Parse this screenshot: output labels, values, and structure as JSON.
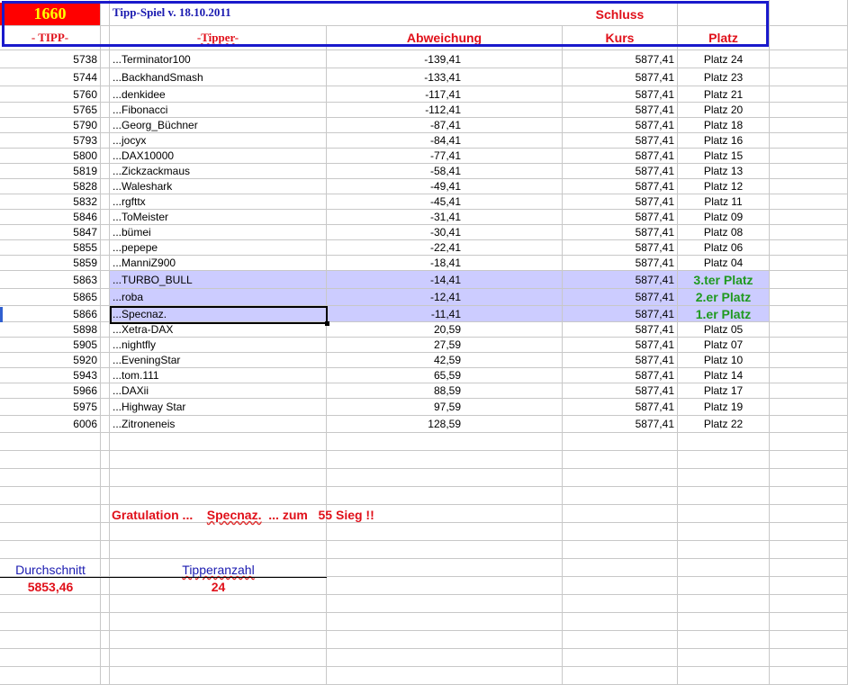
{
  "header": {
    "id_number": "1660",
    "title": "Tipp-Spiel v. 18.10.2011",
    "schluss": "Schluss",
    "col_tipp": "- TIPP-",
    "col_tipper": "-Tipper-",
    "col_abweichung": "Abweichung",
    "col_kurs": "Kurs",
    "col_platz": "Platz"
  },
  "rows": [
    {
      "tipp": "5738",
      "tipper": "...Terminator100",
      "abw": "-139,41",
      "kurs": "5877,41",
      "platz": "Platz 24"
    },
    {
      "tipp": "5744",
      "tipper": "...BackhandSmash",
      "abw": "-133,41",
      "kurs": "5877,41",
      "platz": "Platz 23"
    },
    {
      "tipp": "5760",
      "tipper": "...denkidee",
      "abw": "-117,41",
      "kurs": "5877,41",
      "platz": "Platz 21"
    },
    {
      "tipp": "5765",
      "tipper": "...Fibonacci",
      "abw": "-112,41",
      "kurs": "5877,41",
      "platz": "Platz 20"
    },
    {
      "tipp": "5790",
      "tipper": "...Georg_Büchner",
      "abw": "-87,41",
      "kurs": "5877,41",
      "platz": "Platz 18"
    },
    {
      "tipp": "5793",
      "tipper": "...jocyx",
      "abw": "-84,41",
      "kurs": "5877,41",
      "platz": "Platz 16"
    },
    {
      "tipp": "5800",
      "tipper": "...DAX10000",
      "abw": "-77,41",
      "kurs": "5877,41",
      "platz": "Platz 15"
    },
    {
      "tipp": "5819",
      "tipper": "...Zickzackmaus",
      "abw": "-58,41",
      "kurs": "5877,41",
      "platz": "Platz 13"
    },
    {
      "tipp": "5828",
      "tipper": "...Waleshark",
      "abw": "-49,41",
      "kurs": "5877,41",
      "platz": "Platz 12"
    },
    {
      "tipp": "5832",
      "tipper": "...rgfttx",
      "abw": "-45,41",
      "kurs": "5877,41",
      "platz": "Platz 11"
    },
    {
      "tipp": "5846",
      "tipper": "...ToMeister",
      "abw": "-31,41",
      "kurs": "5877,41",
      "platz": "Platz 09"
    },
    {
      "tipp": "5847",
      "tipper": "...bümei",
      "abw": "-30,41",
      "kurs": "5877,41",
      "platz": "Platz 08"
    },
    {
      "tipp": "5855",
      "tipper": "...pepepe",
      "abw": "-22,41",
      "kurs": "5877,41",
      "platz": "Platz 06"
    },
    {
      "tipp": "5859",
      "tipper": "...ManniZ900",
      "abw": "-18,41",
      "kurs": "5877,41",
      "platz": "Platz 04"
    },
    {
      "tipp": "5863",
      "tipper": "...TURBO_BULL",
      "abw": "-14,41",
      "kurs": "5877,41",
      "platz": "3.ter Platz",
      "winner": true
    },
    {
      "tipp": "5865",
      "tipper": "...roba",
      "abw": "-12,41",
      "kurs": "5877,41",
      "platz": "2.er Platz",
      "winner": true
    },
    {
      "tipp": "5866",
      "tipper": "...Specnaz.",
      "abw": "-11,41",
      "kurs": "5877,41",
      "platz": "1.er Platz",
      "winner": true
    },
    {
      "tipp": "5898",
      "tipper": "...Xetra-DAX",
      "abw": "20,59",
      "kurs": "5877,41",
      "platz": "Platz 05"
    },
    {
      "tipp": "5905",
      "tipper": "...nightfly",
      "abw": "27,59",
      "kurs": "5877,41",
      "platz": "Platz 07"
    },
    {
      "tipp": "5920",
      "tipper": "...EveningStar",
      "abw": "42,59",
      "kurs": "5877,41",
      "platz": "Platz 10"
    },
    {
      "tipp": "5943",
      "tipper": "...tom.111",
      "abw": "65,59",
      "kurs": "5877,41",
      "platz": "Platz 14"
    },
    {
      "tipp": "5966",
      "tipper": "...DAXii",
      "abw": "88,59",
      "kurs": "5877,41",
      "platz": "Platz 17"
    },
    {
      "tipp": "5975",
      "tipper": "...Highway Star",
      "abw": "97,59",
      "kurs": "5877,41",
      "platz": "Platz 19"
    },
    {
      "tipp": "6006",
      "tipper": "...Zitroneneis",
      "abw": "128,59",
      "kurs": "5877,41",
      "platz": "Platz 22"
    }
  ],
  "gratulation": {
    "prefix": "Gratulation ...",
    "name": "Specnaz.",
    "middle": "... zum",
    "suffix": "55 Sieg !!"
  },
  "summary": {
    "durchschnitt_label": "Durchschnitt",
    "durchschnitt_value": "5853,46",
    "tipperanzahl_label": "Tipperanzahl",
    "tipperanzahl_value": "24"
  },
  "colors": {
    "header_red": "#ff0000",
    "id_yellow": "#ffff00",
    "highlight": "#ccccff",
    "border_blue": "#1a1acc"
  }
}
